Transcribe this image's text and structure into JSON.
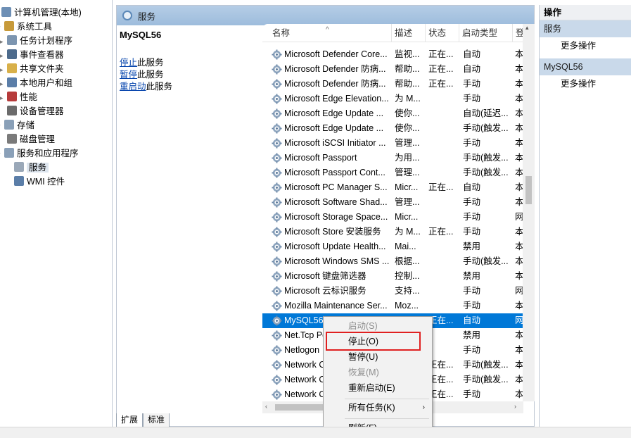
{
  "tree": {
    "items": [
      {
        "label": "计算机管理(本地)",
        "icon": "computer-icon",
        "arrow": "",
        "color": "#6d8fb5"
      },
      {
        "label": "系统工具",
        "icon": "tools-icon",
        "arrow": "▾",
        "color": "#c79a3a"
      },
      {
        "label": "任务计划程序",
        "icon": "clock-icon",
        "arrow": "▸",
        "color": "#7c95b0"
      },
      {
        "label": "事件查看器",
        "icon": "event-viewer-icon",
        "arrow": "▸",
        "color": "#4d6b8c"
      },
      {
        "label": "共享文件夹",
        "icon": "shared-folder-icon",
        "arrow": "▸",
        "color": "#d8b04a"
      },
      {
        "label": "本地用户和组",
        "icon": "users-icon",
        "arrow": "▸",
        "color": "#5b7ea8"
      },
      {
        "label": "性能",
        "icon": "performance-icon",
        "arrow": "▸",
        "color": "#b63b3b"
      },
      {
        "label": "设备管理器",
        "icon": "device-manager-icon",
        "arrow": "",
        "color": "#6b6b6b"
      },
      {
        "label": "存储",
        "icon": "storage-icon",
        "arrow": "▾",
        "color": "#8aa0b8"
      },
      {
        "label": "磁盘管理",
        "icon": "disk-icon",
        "arrow": "",
        "color": "#7a7a7a"
      },
      {
        "label": "服务和应用程序",
        "icon": "services-apps-icon",
        "arrow": "▾",
        "color": "#8aa0b8"
      },
      {
        "label": "服务",
        "icon": "gear-icon",
        "arrow": "",
        "color": "#9aa8b8"
      },
      {
        "label": "WMI 控件",
        "icon": "wmi-icon",
        "arrow": "",
        "color": "#5b7ea8"
      }
    ]
  },
  "header": {
    "title": "服务"
  },
  "detail": {
    "service_name": "MySQL56",
    "stop_link": "停止",
    "stop_suffix": "此服务",
    "pause_link": "暂停",
    "pause_suffix": "此服务",
    "restart_link": "重启动",
    "restart_suffix": "此服务"
  },
  "columns": [
    "名称",
    "描述",
    "状态",
    "启动类型",
    "登"
  ],
  "rows": [
    {
      "name": "Microsoft Defender Core...",
      "desc": "监视...",
      "status": "正在...",
      "startup": "自动",
      "logon": "本"
    },
    {
      "name": "Microsoft Defender 防病...",
      "desc": "帮助...",
      "status": "正在...",
      "startup": "自动",
      "logon": "本"
    },
    {
      "name": "Microsoft Defender 防病...",
      "desc": "帮助...",
      "status": "正在...",
      "startup": "手动",
      "logon": "本"
    },
    {
      "name": "Microsoft Edge Elevation...",
      "desc": "为 M...",
      "status": "",
      "startup": "手动",
      "logon": "本"
    },
    {
      "name": "Microsoft Edge Update ...",
      "desc": "使你...",
      "status": "",
      "startup": "自动(延迟...",
      "logon": "本"
    },
    {
      "name": "Microsoft Edge Update ...",
      "desc": "使你...",
      "status": "",
      "startup": "手动(触发...",
      "logon": "本"
    },
    {
      "name": "Microsoft iSCSI Initiator ...",
      "desc": "管理...",
      "status": "",
      "startup": "手动",
      "logon": "本"
    },
    {
      "name": "Microsoft Passport",
      "desc": "为用...",
      "status": "",
      "startup": "手动(触发...",
      "logon": "本"
    },
    {
      "name": "Microsoft Passport Cont...",
      "desc": "管理...",
      "status": "",
      "startup": "手动(触发...",
      "logon": "本"
    },
    {
      "name": "Microsoft PC Manager S...",
      "desc": "Micr...",
      "status": "正在...",
      "startup": "自动",
      "logon": "本"
    },
    {
      "name": "Microsoft Software Shad...",
      "desc": "管理...",
      "status": "",
      "startup": "手动",
      "logon": "本"
    },
    {
      "name": "Microsoft Storage Space...",
      "desc": "Micr...",
      "status": "",
      "startup": "手动",
      "logon": "网"
    },
    {
      "name": "Microsoft Store 安装服务",
      "desc": "为 M...",
      "status": "正在...",
      "startup": "手动",
      "logon": "本"
    },
    {
      "name": "Microsoft Update Health...",
      "desc": "Mai...",
      "status": "",
      "startup": "禁用",
      "logon": "本"
    },
    {
      "name": "Microsoft Windows SMS ...",
      "desc": "根据...",
      "status": "",
      "startup": "手动(触发...",
      "logon": "本"
    },
    {
      "name": "Microsoft 键盘筛选器",
      "desc": "控制...",
      "status": "",
      "startup": "禁用",
      "logon": "本"
    },
    {
      "name": "Microsoft 云标识服务",
      "desc": "支持...",
      "status": "",
      "startup": "手动",
      "logon": "网"
    },
    {
      "name": "Mozilla Maintenance Ser...",
      "desc": "Moz...",
      "status": "",
      "startup": "手动",
      "logon": "本"
    },
    {
      "name": "MySQL56",
      "desc": "",
      "status": "正在...",
      "startup": "自动",
      "logon": "网"
    },
    {
      "name": "Net.Tcp Po",
      "desc": "",
      "status": "",
      "startup": "禁用",
      "logon": "本"
    },
    {
      "name": "Netlogon",
      "desc": "",
      "status": "",
      "startup": "手动",
      "logon": "本"
    },
    {
      "name": "Network C",
      "desc": "",
      "status": "正在...",
      "startup": "手动(触发...",
      "logon": "本"
    },
    {
      "name": "Network C",
      "desc": "",
      "status": "正在...",
      "startup": "手动(触发...",
      "logon": "本"
    },
    {
      "name": "Network C",
      "desc": "",
      "status": "正在...",
      "startup": "手动",
      "logon": "本"
    }
  ],
  "selected_row": 18,
  "tabs": [
    "扩展",
    "标准"
  ],
  "actions": {
    "title": "操作",
    "section1": "服务",
    "more1": "更多操作",
    "section2": "MySQL56",
    "more2": "更多操作"
  },
  "context_menu": {
    "start": "启动(S)",
    "stop": "停止(O)",
    "pause": "暂停(U)",
    "resume": "恢复(M)",
    "restart": "重新启动(E)",
    "all_tasks": "所有任务(K)",
    "refresh": "刷新(F)"
  },
  "colors": {
    "selection": "#0078d7",
    "header": "#9dbcdc",
    "highlight_box": "#e02020"
  }
}
